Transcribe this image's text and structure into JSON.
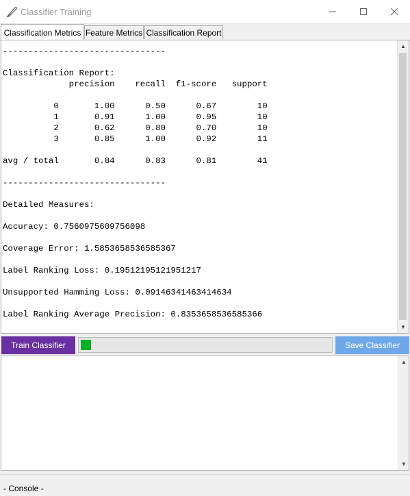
{
  "window": {
    "title": "Classifier Training"
  },
  "tabs": [
    {
      "label": "Classification Metrics",
      "active": true
    },
    {
      "label": "Feature Metrics",
      "active": false
    },
    {
      "label": "Classification Report",
      "active": false
    }
  ],
  "report": {
    "lines": [
      "--------------------------------",
      "",
      "Classification Report:",
      "             precision    recall  f1-score   support",
      "",
      "          0       1.00      0.50      0.67        10",
      "          1       0.91      1.00      0.95        10",
      "          2       0.62      0.80      0.70        10",
      "          3       0.85      1.00      0.92        11",
      "",
      "avg / total       0.84      0.83      0.81        41",
      "",
      "--------------------------------",
      "",
      "Detailed Measures:",
      "",
      "Accuracy: 0.7560975609756098",
      "",
      "Coverage Error: 1.5853658536585367",
      "",
      "Label Ranking Loss: 0.19512195121951217",
      "",
      "Unsupported Hamming Loss: 0.09146341463414634",
      "",
      "Label Ranking Average Precision: 0.8353658536585366"
    ]
  },
  "controls": {
    "train_label": "Train Classifier",
    "save_label": "Save Classifier",
    "progress": 0.04
  },
  "console": {
    "label": "- Console -",
    "text": ""
  },
  "colors": {
    "train_button": "#6a2fa0",
    "save_button": "#6fa8e8",
    "progress_fill": "#06b025"
  }
}
